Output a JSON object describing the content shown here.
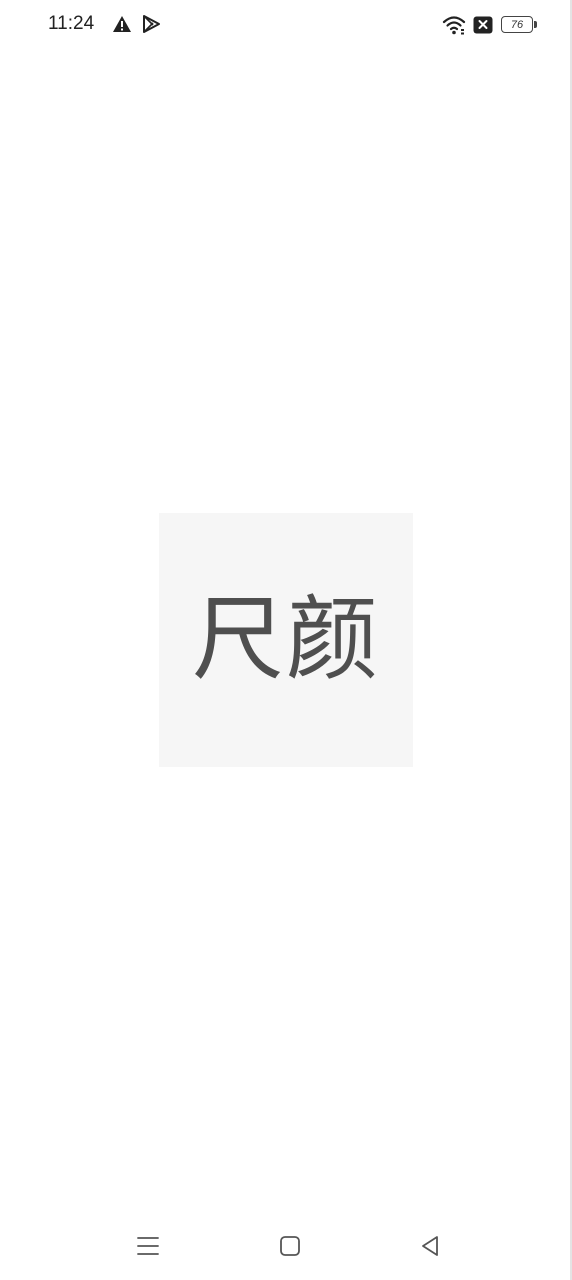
{
  "status_bar": {
    "time": "11:24",
    "left_icons": [
      "warning-icon",
      "play-store-icon"
    ],
    "right_icons": [
      "wifi-icon",
      "no-sim-icon"
    ],
    "battery_level": "76"
  },
  "splash": {
    "app_name": "尺颜",
    "logo_background": "#f6f6f6",
    "text_color": "#4f4f4f"
  },
  "nav_bar": {
    "buttons": [
      "menu-icon",
      "home-icon",
      "back-icon"
    ]
  }
}
